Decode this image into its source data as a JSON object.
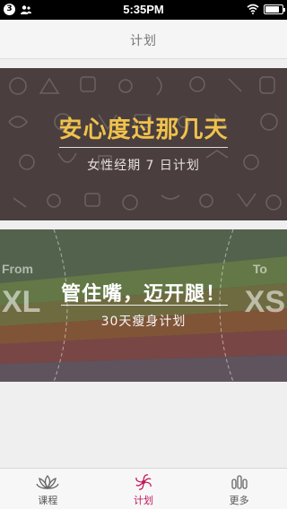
{
  "status_bar": {
    "notification_count": "3",
    "time": "5:35PM",
    "battery_level": 0.85
  },
  "header": {
    "title": "计划"
  },
  "banners": [
    {
      "title": "安心度过那几天",
      "subtitle": "女性经期 7 日计划",
      "title_color": "#f0c24d"
    },
    {
      "from_label": "From",
      "size_from": "XL",
      "to_label": "To",
      "size_to": "XS",
      "title": "管住嘴，迈开腿！",
      "subtitle": "30天瘦身计划"
    }
  ],
  "tab_bar": {
    "tabs": [
      {
        "label": "课程",
        "icon": "lotus-icon",
        "active": false
      },
      {
        "label": "计划",
        "icon": "pinwheel-icon",
        "active": true
      },
      {
        "label": "更多",
        "icon": "more-icon",
        "active": false
      }
    ],
    "accent_color": "#c2185b"
  }
}
